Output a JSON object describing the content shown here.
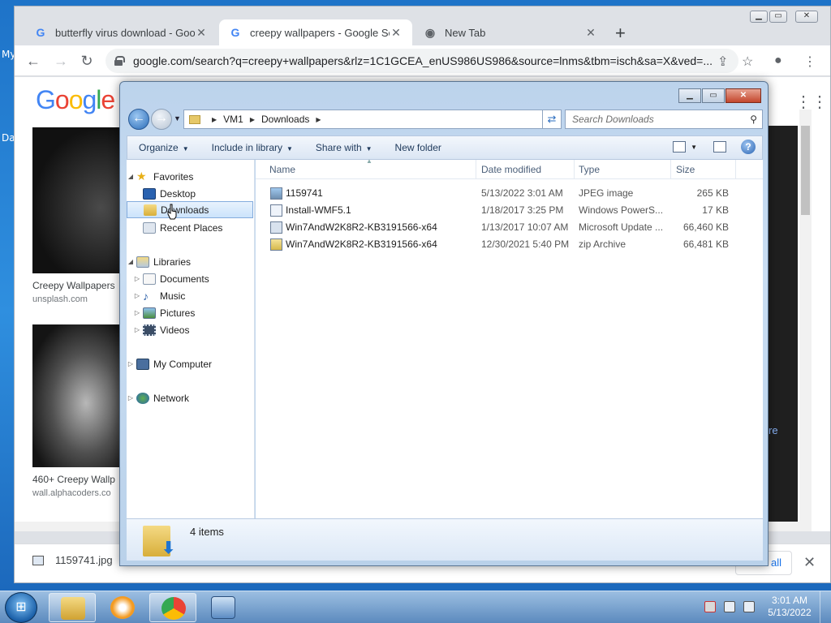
{
  "desktop": {
    "label_my": "My",
    "label_da": "Da"
  },
  "chrome": {
    "tabs": [
      {
        "title": "butterfly virus download - Googl",
        "favicon": "G"
      },
      {
        "title": "creepy wallpapers - Google Sear",
        "favicon": "G"
      },
      {
        "title": "New Tab",
        "favicon": "chrome-icon"
      }
    ],
    "url": "google.com/search?q=creepy+wallpapers&rlz=1C1GCEA_enUS986US986&source=lnms&tbm=isch&sa=X&ved=...",
    "results": [
      {
        "caption": "Creepy Wallpapers",
        "source": "unsplash.com"
      },
      {
        "caption": "460+ Creepy Wallp",
        "source": "wall.alphacoders.co"
      }
    ],
    "partial_text": "re",
    "download_bar": {
      "file": "1159741.jpg",
      "show_all": "all"
    }
  },
  "explorer": {
    "breadcrumb": [
      "VM1",
      "Downloads"
    ],
    "search_placeholder": "Search Downloads",
    "commands": [
      {
        "label": "Organize",
        "dropdown": true
      },
      {
        "label": "Include in library",
        "dropdown": true
      },
      {
        "label": "Share with",
        "dropdown": true
      },
      {
        "label": "New folder",
        "dropdown": false
      }
    ],
    "nav": {
      "favorites": "Favorites",
      "favorite_items": [
        "Desktop",
        "Downloads",
        "Recent Places"
      ],
      "libraries": "Libraries",
      "library_items": [
        "Documents",
        "Music",
        "Pictures",
        "Videos"
      ],
      "computer": "My Computer",
      "network": "Network"
    },
    "columns": [
      "Name",
      "Date modified",
      "Type",
      "Size"
    ],
    "files": [
      {
        "name": "1159741",
        "date": "5/13/2022 3:01 AM",
        "type": "JPEG image",
        "size": "265 KB"
      },
      {
        "name": "Install-WMF5.1",
        "date": "1/18/2017 3:25 PM",
        "type": "Windows PowerS...",
        "size": "17 KB"
      },
      {
        "name": "Win7AndW2K8R2-KB3191566-x64",
        "date": "1/13/2017 10:07 AM",
        "type": "Microsoft Update ...",
        "size": "66,460 KB"
      },
      {
        "name": "Win7AndW2K8R2-KB3191566-x64",
        "date": "12/30/2021 5:40 PM",
        "type": "zip Archive",
        "size": "66,481 KB"
      }
    ],
    "item_count": "4 items"
  },
  "taskbar": {
    "time": "3:01 AM",
    "date": "5/13/2022"
  }
}
